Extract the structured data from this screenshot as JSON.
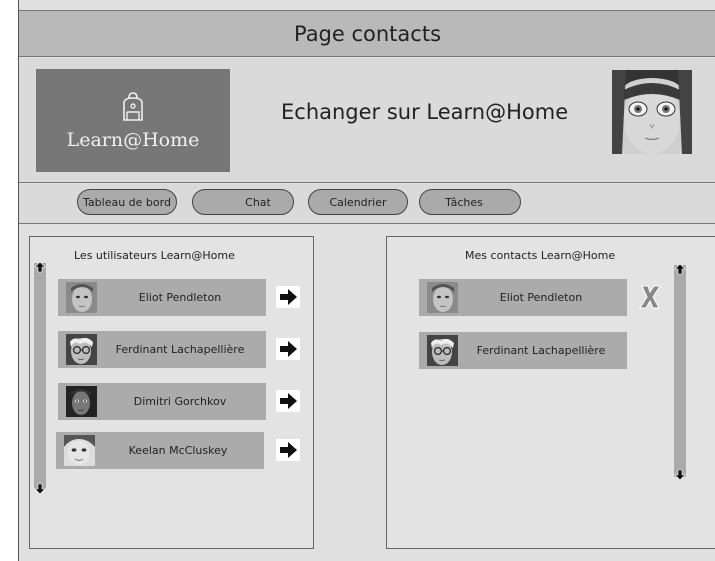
{
  "header": {
    "title": "Page contacts"
  },
  "banner": {
    "logo_text": "Learn@Home",
    "logo_icon": "backpack-icon",
    "tagline": "Echanger sur Learn@Home",
    "profile_avatar": "profile-avatar"
  },
  "nav": {
    "items": [
      {
        "label": "Tableau de bord"
      },
      {
        "label": "Chat"
      },
      {
        "label": "Calendrier"
      },
      {
        "label": "Tâches"
      }
    ]
  },
  "users_panel": {
    "title": "Les utilisateurs Learn@Home",
    "users": [
      {
        "name": "Eliot Pendleton",
        "action_icon": "arrow-right-icon"
      },
      {
        "name": "Ferdinant Lachapellière",
        "action_icon": "arrow-right-icon"
      },
      {
        "name": "Dimitri Gorchkov",
        "action_icon": "arrow-right-icon"
      },
      {
        "name": "Keelan McCluskey",
        "action_icon": "arrow-right-icon"
      }
    ]
  },
  "contacts_panel": {
    "title": "Mes contacts Learn@Home",
    "contacts": [
      {
        "name": "Eliot Pendleton",
        "action_icon": "remove-x-icon"
      },
      {
        "name": "Ferdinant Lachapellière"
      }
    ]
  },
  "colors": {
    "header_bg": "#b9b9b9",
    "page_bg": "#e0e0e0",
    "logo_bg": "#777777",
    "row_bg": "#ababab",
    "button_bg": "#aaaaaa"
  }
}
